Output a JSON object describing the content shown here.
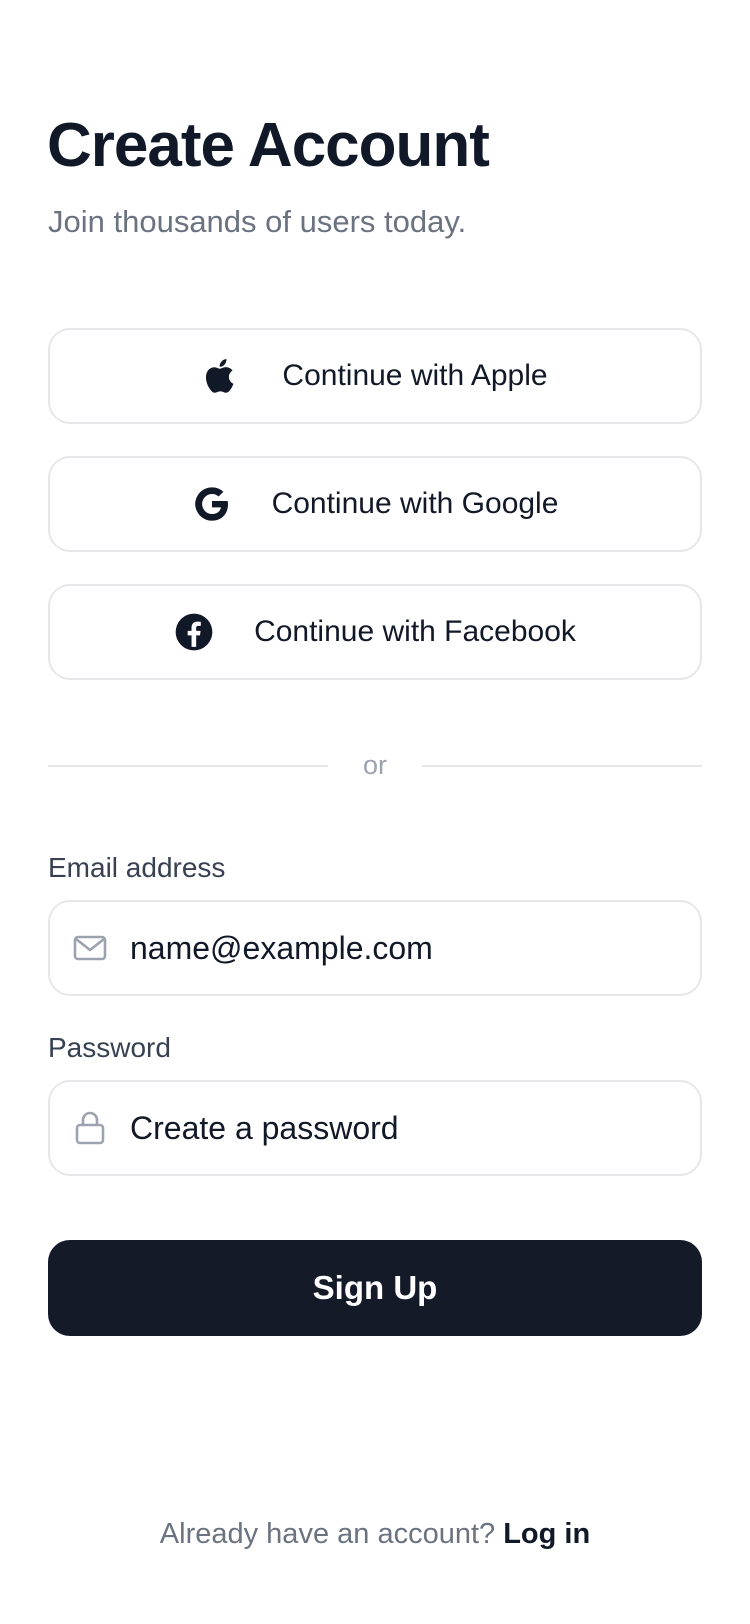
{
  "header": {
    "title": "Create Account",
    "subtitle": "Join thousands of users today."
  },
  "social": [
    {
      "provider": "apple",
      "label": "Continue with Apple",
      "icon": "apple-icon"
    },
    {
      "provider": "google",
      "label": "Continue with Google",
      "icon": "google-icon"
    },
    {
      "provider": "facebook",
      "label": "Continue with Facebook",
      "icon": "facebook-icon"
    }
  ],
  "divider": {
    "text": "or"
  },
  "form": {
    "email": {
      "label": "Email address",
      "placeholder": "name@example.com",
      "value": "",
      "icon": "mail-icon"
    },
    "password": {
      "label": "Password",
      "placeholder": "Create a password",
      "value": "",
      "icon": "lock-icon"
    },
    "submit_label": "Sign Up"
  },
  "footer": {
    "prompt": "Already have an account?",
    "link_label": "Log in"
  },
  "colors": {
    "primary": "#151a28",
    "text": "#111827",
    "muted": "#6b7280",
    "border": "#e5e7eb"
  }
}
